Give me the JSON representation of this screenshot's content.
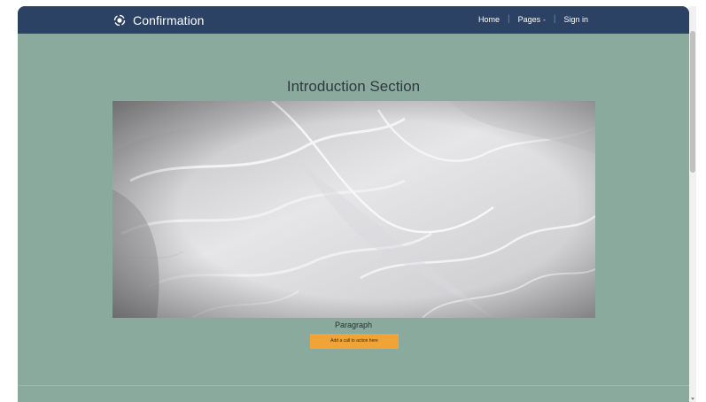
{
  "navbar": {
    "brand_title": "Confirmation",
    "brand_icon": "circle-logo-icon",
    "links": {
      "home": "Home",
      "pages": "Pages",
      "signin": "Sign in"
    },
    "separator": "|",
    "pages_caret": "-"
  },
  "main": {
    "title": "Introduction Section",
    "image": "white tulle ruffles photo",
    "paragraph": "Paragraph",
    "cta_label": "Add a call to action here"
  },
  "colors": {
    "navbar_bg": "#2c4264",
    "page_bg": "#8aaa9d",
    "cta_bg": "#f0a336"
  }
}
